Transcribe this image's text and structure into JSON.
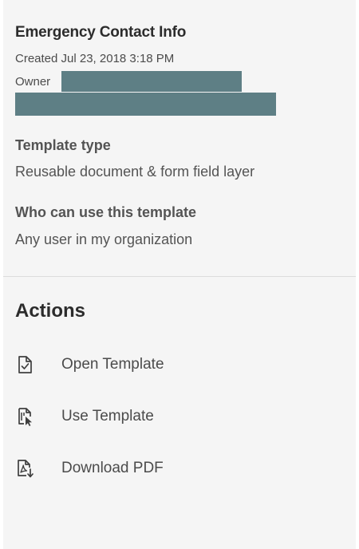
{
  "template": {
    "title": "Emergency Contact Info",
    "created": "Created Jul 23, 2018 3:18 PM",
    "owner_label": "Owner"
  },
  "details": {
    "type_label": "Template type",
    "type_value": "Reusable document & form field layer",
    "access_label": "Who can use this template",
    "access_value": "Any user in my organization"
  },
  "actions": {
    "heading": "Actions",
    "items": [
      {
        "label": "Open Template",
        "icon": "document-check-icon"
      },
      {
        "label": "Use Template",
        "icon": "document-cursor-icon"
      },
      {
        "label": "Download PDF",
        "icon": "pdf-download-icon"
      }
    ]
  },
  "colors": {
    "panel_bg": "#f5f5f5",
    "redaction": "#5e7f85",
    "text": "#4b4b4b",
    "heading": "#2c2c2c"
  }
}
